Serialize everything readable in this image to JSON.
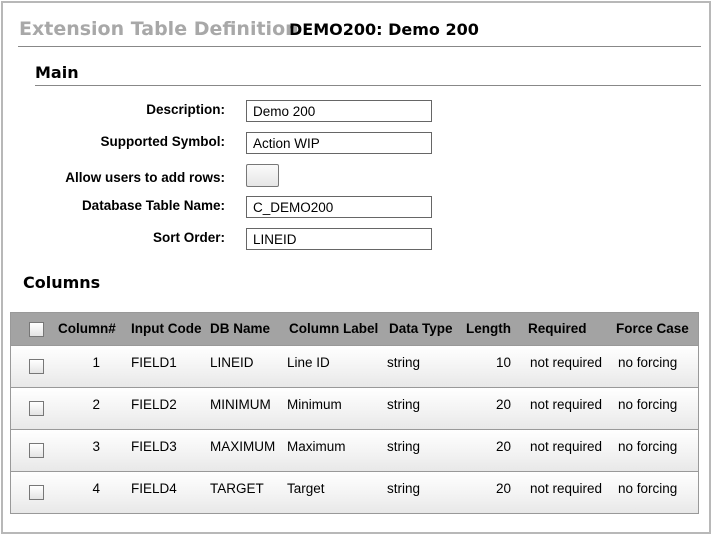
{
  "header": {
    "title": "Extension Table Definition",
    "subtitle": "DEMO200: Demo 200"
  },
  "main": {
    "section_title": "Main",
    "fields": {
      "description": {
        "label": "Description:",
        "value": "Demo 200"
      },
      "supported_symbol": {
        "label": "Supported Symbol:",
        "value": "Action WIP"
      },
      "allow_add_rows": {
        "label": "Allow users to add rows:",
        "checked": false
      },
      "db_table_name": {
        "label": "Database Table Name:",
        "value": "C_DEMO200"
      },
      "sort_order": {
        "label": "Sort Order:",
        "value": "LINEID"
      }
    }
  },
  "columns": {
    "section_title": "Columns",
    "headers": [
      "Column#",
      "Input Code",
      "DB Name",
      "Column Label",
      "Data Type",
      "Length",
      "Required",
      "Force Case"
    ],
    "rows": [
      [
        "1",
        "FIELD1",
        "LINEID",
        "Line ID",
        "string",
        "10",
        "not required",
        "no forcing"
      ],
      [
        "2",
        "FIELD2",
        "MINIMUM",
        "Minimum",
        "string",
        "20",
        "not required",
        "no forcing"
      ],
      [
        "3",
        "FIELD3",
        "MAXIMUM",
        "Maximum",
        "string",
        "20",
        "not required",
        "no forcing"
      ],
      [
        "4",
        "FIELD4",
        "TARGET",
        "Target",
        "string",
        "20",
        "not required",
        "no forcing"
      ]
    ]
  }
}
